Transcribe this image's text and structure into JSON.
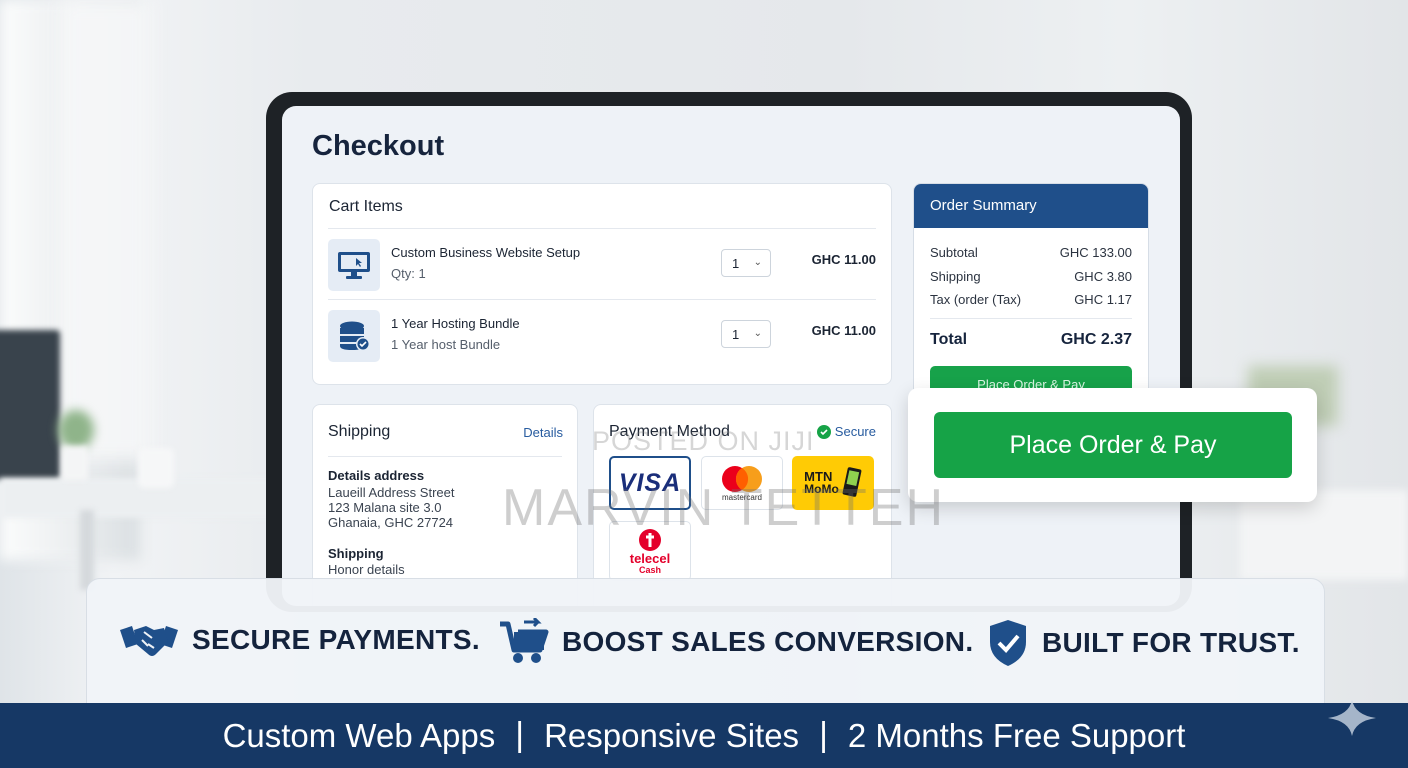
{
  "checkout": {
    "title": "Checkout",
    "cart": {
      "heading": "Cart Items",
      "items": [
        {
          "name": "Custom Business Website Setup",
          "sub": "Qty: 1",
          "qty": "1",
          "price": "GHC 11.00",
          "icon": "monitor-icon"
        },
        {
          "name": "1 Year Hosting Bundle",
          "sub": "1 Year host Bundle",
          "qty": "1",
          "price": "GHC 11.00",
          "icon": "database-icon"
        }
      ]
    },
    "summary": {
      "heading": "Order Summary",
      "rows": [
        {
          "label": "Subtotal",
          "value": "GHC 133.00"
        },
        {
          "label": "Shipping",
          "value": "GHC 3.80"
        },
        {
          "label": "Tax (order (Tax)",
          "value": "GHC 1.17"
        }
      ],
      "total_label": "Total",
      "total_value": "GHC 2.37",
      "button_label": "Place Order & Pay"
    },
    "shipping": {
      "heading": "Shipping",
      "link": "Details",
      "address_label": "Details address",
      "address_lines": [
        "Laueill Address Street",
        "123 Malana site 3.0",
        "Ghanaia, GHC 27724"
      ],
      "shipping_label": "Shipping",
      "shipping_value": "Honor details"
    },
    "payment": {
      "heading": "Payment Method",
      "secure_label": "Secure",
      "methods": {
        "visa": "VISA",
        "mastercard": "mastercard",
        "mtn": "MTN",
        "momo": "MoMo",
        "telecel": "telecel",
        "cash": "Cash"
      }
    }
  },
  "cta": {
    "label": "Place Order & Pay"
  },
  "watermark": {
    "line1": "POSTED ON JIJI",
    "line2": "MARVIN TETTEH"
  },
  "features": [
    {
      "label": "SECURE PAYMENTS.",
      "icon": "handshake-icon"
    },
    {
      "label": "BOOST SALES CONVERSION.",
      "icon": "cart-icon"
    },
    {
      "label": "BUILT FOR TRUST.",
      "icon": "shield-check-icon"
    }
  ],
  "bottom_bar": [
    "Custom Web Apps",
    "Responsive Sites",
    "2 Months Free Support"
  ],
  "colors": {
    "brand_navy": "#163865",
    "accent_green": "#16a347",
    "summary_blue": "#1f4f8a"
  }
}
